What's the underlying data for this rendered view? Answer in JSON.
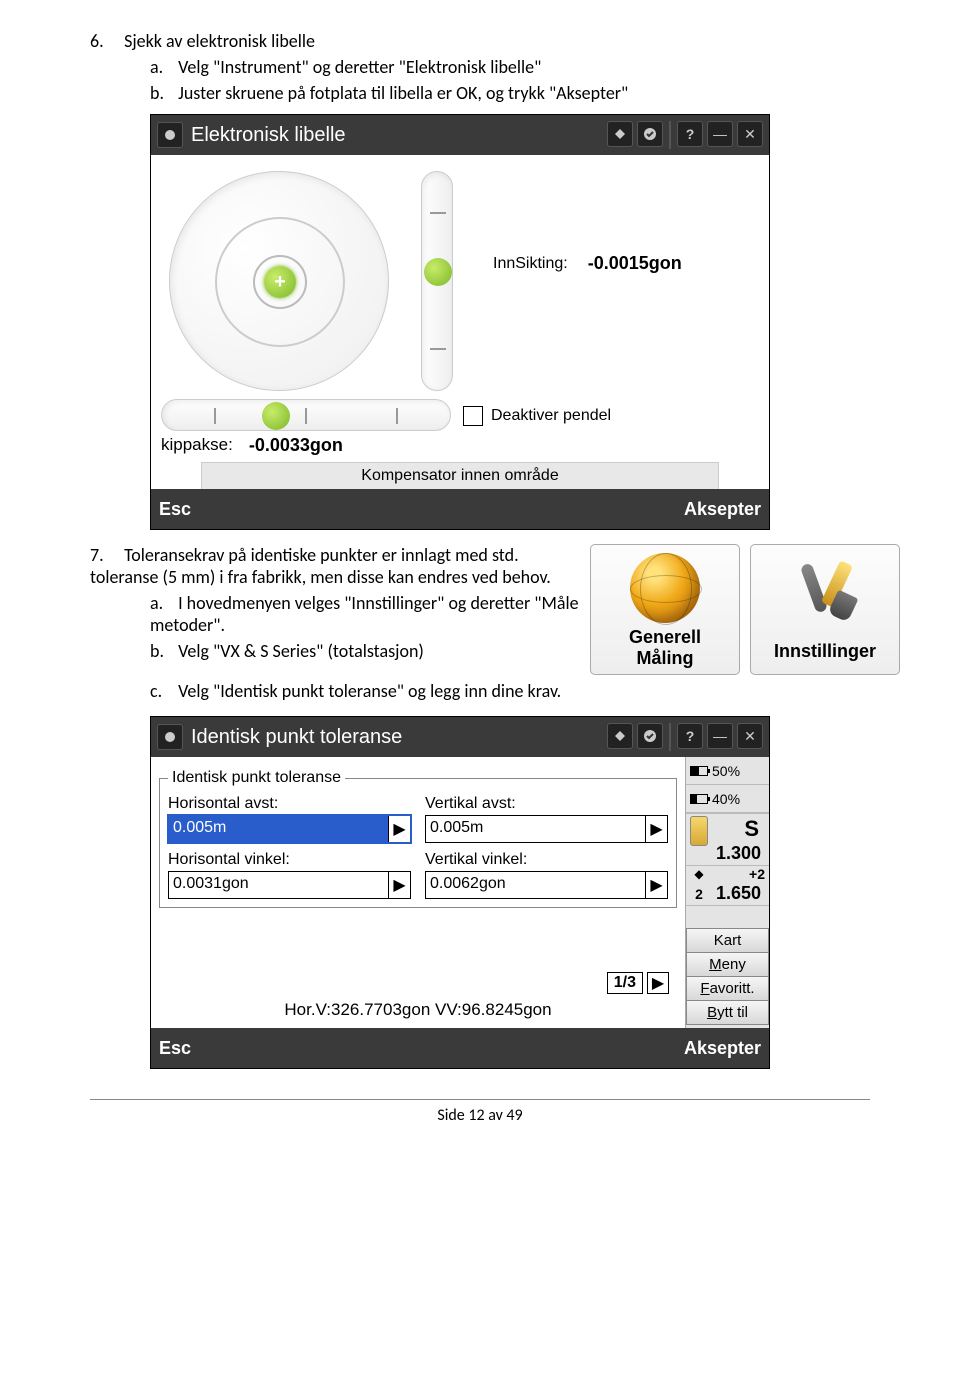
{
  "section6": {
    "num": "6.",
    "title": "Sjekk av elektronisk libelle",
    "a_letter": "a.",
    "a_text": "Velg \"Instrument\" og deretter \"Elektronisk libelle\"",
    "b_letter": "b.",
    "b_text": "Juster skruene på fotplata til libella er OK, og trykk \"Aksepter\""
  },
  "screenshot1": {
    "title": "Elektronisk libelle",
    "innsikting_label": "InnSikting:",
    "innsikting_value": "-0.0015gon",
    "deaktiver_label": "Deaktiver pendel",
    "kippakse_label": "kippakse:",
    "kippakse_value": "-0.0033gon",
    "status": "Kompensator innen område",
    "esc": "Esc",
    "aksepter": "Aksepter",
    "help": "?",
    "minus": "—",
    "close": "✕"
  },
  "section7": {
    "num": "7.",
    "text": "Toleransekrav på identiske punkter er innlagt med std. toleranse (5 mm) i fra fabrikk, men disse kan endres ved behov.",
    "a_letter": "a.",
    "a_text": "I hovedmenyen velges \"Innstillinger\" og deretter \"Måle metoder\".",
    "b_letter": "b.",
    "b_text": "Velg \"VX & S Series\" (totalstasjon)",
    "c_letter": "c.",
    "c_text": "Velg \"Identisk punkt toleranse\" og legg inn dine krav."
  },
  "icons": {
    "generell_l1": "Generell",
    "generell_l2": "Måling",
    "innstillinger": "Innstillinger"
  },
  "screenshot2": {
    "title": "Identisk punkt toleranse",
    "legend": "Identisk punkt toleranse",
    "fields": {
      "horis_avst_label": "Horisontal avst:",
      "horis_avst_value": "0.005m",
      "vert_avst_label": "Vertikal avst:",
      "vert_avst_value": "0.005m",
      "horis_vinkel_label": "Horisontal vinkel:",
      "horis_vinkel_value": "0.0031gon",
      "vert_vinkel_label": "Vertikal vinkel:",
      "vert_vinkel_value": "0.0062gon"
    },
    "side": {
      "batt1": "50%",
      "batt2": "40%",
      "s_label": "S",
      "height1": "1.300",
      "plus2": "+2",
      "num2": "2",
      "height2": "1.650",
      "kart": "Kart",
      "meny": "Meny",
      "favoritt": "Favoritt.",
      "bytt": "Bytt til"
    },
    "pager": "1/3",
    "hor_line": "Hor.V:326.7703gon  VV:96.8245gon",
    "esc": "Esc",
    "aksepter": "Aksepter",
    "help": "?",
    "minus": "—",
    "close": "✕"
  },
  "footer": "Side 12 av 49"
}
